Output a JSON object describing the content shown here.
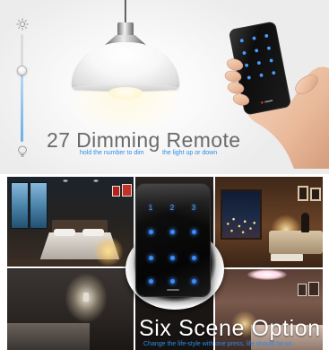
{
  "dimming": {
    "title": "27 Dimming Remote",
    "subtitle_left": "hold the number to dim",
    "subtitle_right": "the light up or down"
  },
  "scenes": {
    "title": "Six Scene Option",
    "subtitle": "Change the life-style with one press, life should be so"
  },
  "dimmer": {
    "level": 0.66,
    "top_icon": "sun-icon",
    "bottom_icon": "bulb-icon"
  },
  "remote": {
    "key_labels": [
      "1",
      "2",
      "3"
    ]
  },
  "colors": {
    "accent_blue": "#2e8be6",
    "title_gray": "#6a6a6a",
    "key_glow": "#3b8cff",
    "remote_body": "#0b0b0b"
  }
}
